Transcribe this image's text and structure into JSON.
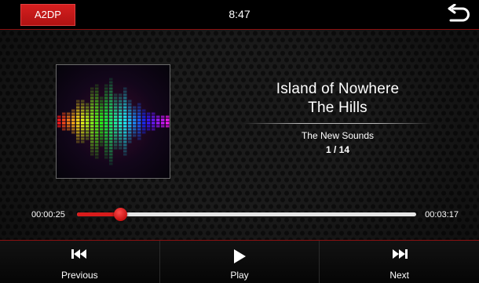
{
  "status_bar": {
    "source": "A2DP",
    "time": "8:47",
    "back_icon": "return-arrow-icon"
  },
  "now_playing": {
    "album_art": "equalizer-artwork",
    "title": "Island of Nowhere",
    "artist": "The Hills",
    "album": "The New Sounds",
    "track_position": "1 / 14"
  },
  "progress": {
    "elapsed": "00:00:25",
    "total": "00:03:17",
    "fraction": 0.127
  },
  "controls": {
    "previous": {
      "label": "Previous",
      "icon": "skip-previous-icon"
    },
    "play": {
      "label": "Play",
      "icon": "play-icon"
    },
    "next": {
      "label": "Next",
      "icon": "skip-next-icon"
    }
  },
  "colors": {
    "accent": "#d81b1b",
    "background": "#1b1b1b",
    "text": "#ffffff"
  }
}
